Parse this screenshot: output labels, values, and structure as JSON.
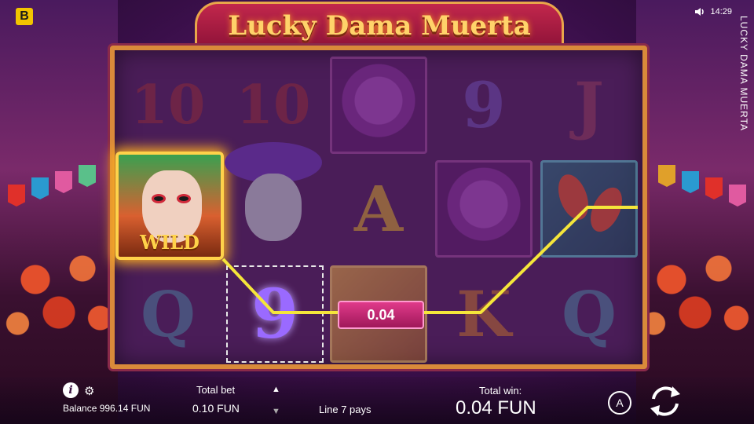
{
  "brand": {
    "logo_letter": "B"
  },
  "clock": {
    "time": "14:29",
    "sound_icon": "speaker-icon"
  },
  "game": {
    "title": "Lucky Dama Muerta",
    "side_title": "LUCKY DAMA MUERTA"
  },
  "reels": {
    "wild_label": "WILD",
    "symbols": {
      "r0c0": "10",
      "r0c1": "10",
      "r0c3": "9",
      "r0c4": "J",
      "r1c2": "A",
      "r2c0": "Q",
      "r2c1": "9",
      "r2c3": "K",
      "r2c4": "Q"
    },
    "win_amount": "0.04"
  },
  "bottom": {
    "info_icon": "info-icon",
    "settings_icon": "gear-icon",
    "balance": "Balance 996.14 FUN",
    "total_bet_label": "Total bet",
    "total_bet_value": "0.10 FUN",
    "line_pays": "Line 7 pays",
    "total_win_label": "Total win:",
    "total_win_value": "0.04 FUN",
    "autoplay_label": "A"
  },
  "colors": {
    "payline": "#f5e63a",
    "accent_gold": "#ffd24a",
    "banner": "#c2274c"
  }
}
